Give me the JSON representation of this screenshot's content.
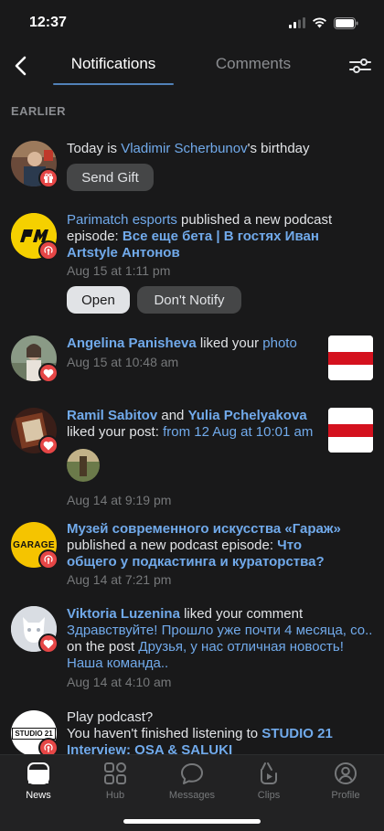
{
  "status": {
    "time": "12:37"
  },
  "header": {
    "tabs": [
      {
        "label": "Notifications",
        "active": true
      },
      {
        "label": "Comments",
        "active": false
      }
    ]
  },
  "section_label": "EARLIER",
  "items": [
    {
      "type": "birthday",
      "prefix": "Today is ",
      "name": "Vladimir Scherbunov",
      "suffix": "'s birthday",
      "button": "Send Gift",
      "avatar_icon": "gift-icon"
    },
    {
      "type": "podcast",
      "source": "Parimatch esports",
      "action": " published a new podcast episode: ",
      "title": "Все еще бета | В гостях Иван Artstyle Антонов",
      "time": "Aug 15 at 1:11 pm",
      "buttons": [
        "Open",
        "Don't Notify"
      ],
      "avatar_icon": "podcast-icon"
    },
    {
      "type": "like",
      "name": "Angelina Panisheva",
      "action": " liked your ",
      "target": "photo",
      "time": "Aug 15 at 10:48 am",
      "avatar_icon": "heart-icon"
    },
    {
      "type": "like",
      "name1": "Ramil Sabitov",
      "and": " and ",
      "name2": "Yulia Pchelyakova",
      "action": "liked your post: ",
      "target": "from 12 Aug at 10:01 am",
      "time": "Aug 14 at 9:19 pm",
      "avatar_icon": "heart-icon"
    },
    {
      "type": "podcast",
      "source": "Музей современного искусства «Гараж»",
      "action": " published a new podcast episode: ",
      "title": "Что общего у подкастинга и кураторства?",
      "time": "Aug 14 at 7:21 pm",
      "avatar_text": "GARAGE",
      "avatar_icon": "podcast-icon"
    },
    {
      "type": "comment-like",
      "name": "Viktoria Luzenina",
      "action": " liked your comment",
      "comment": "Здравствуйте! Прошло уже почти 4 месяца, со..",
      "on_post": " on the post ",
      "post": "Друзья, у нас отличная новость! Наша команда..",
      "time": "Aug 14 at 4:10 am",
      "avatar_icon": "heart-icon"
    },
    {
      "type": "play-podcast",
      "title": "Play podcast?",
      "text": "You haven't finished listening to ",
      "podcast": "STUDIO 21 Interview: OSA & SALUKI",
      "avatar_text": "STUDIO 21",
      "avatar_icon": "podcast-icon"
    }
  ],
  "tabbar": [
    {
      "label": "News",
      "icon": "news-icon",
      "active": true
    },
    {
      "label": "Hub",
      "icon": "hub-icon",
      "active": false
    },
    {
      "label": "Messages",
      "icon": "messages-icon",
      "active": false
    },
    {
      "label": "Clips",
      "icon": "clips-icon",
      "active": false
    },
    {
      "label": "Profile",
      "icon": "profile-icon",
      "active": false
    }
  ],
  "colors": {
    "background": "#19191a",
    "link": "#71aaeb",
    "accent": "#5181b8",
    "badge_red": "#e64646",
    "secondary_text": "#76787a"
  }
}
